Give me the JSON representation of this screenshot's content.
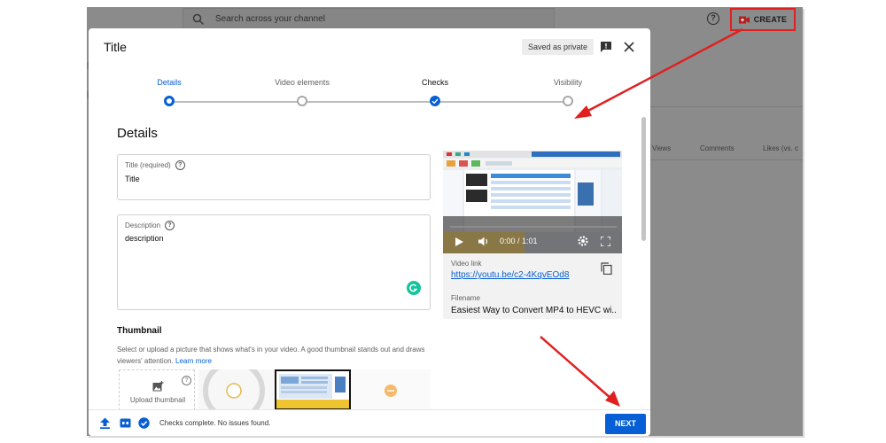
{
  "topbar": {
    "search_placeholder": "Search across your channel",
    "help_icon": "help-circle-icon",
    "create_label": "CREATE",
    "create_icon": "video-camera-icon"
  },
  "background": {
    "columns": [
      "Views",
      "Comments",
      "Likes (vs. c"
    ]
  },
  "dialog": {
    "title": "Title",
    "saved_status": "Saved as private",
    "steps": [
      {
        "label": "Details",
        "state": "active"
      },
      {
        "label": "Video elements",
        "state": "pending"
      },
      {
        "label": "Checks",
        "state": "done"
      },
      {
        "label": "Visibility",
        "state": "pending"
      }
    ],
    "section_heading": "Details",
    "title_field": {
      "label": "Title (required)",
      "value": "Title"
    },
    "description_field": {
      "label": "Description",
      "value": "description"
    },
    "thumbnail": {
      "heading": "Thumbnail",
      "description": "Select or upload a picture that shows what's in your video. A good thumbnail stands out and draws viewers' attention.",
      "learn_more": "Learn more",
      "upload_label": "Upload thumbnail"
    },
    "video": {
      "time": "0:00 / 1:01",
      "link_label": "Video link",
      "link": "https://youtu.be/c2-4KqvEOd8",
      "filename_label": "Filename",
      "filename": "Easiest Way to Convert MP4 to HEVC wi..."
    },
    "footer": {
      "status": "Checks complete. No issues found.",
      "next_label": "NEXT"
    }
  },
  "colors": {
    "accent": "#065fd4",
    "annotation": "#e02020"
  }
}
